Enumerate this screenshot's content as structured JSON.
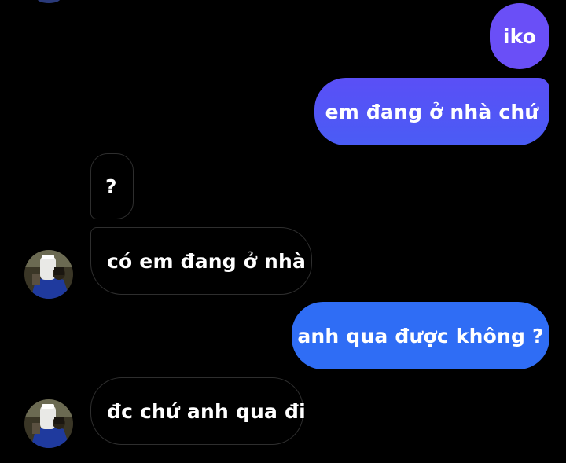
{
  "theme": {
    "background": "#000000",
    "outgoing_gradient_top": "#6f4cf6",
    "outgoing_gradient_bottom": "#2f6df5",
    "incoming_background": "#000000",
    "incoming_border": "#2e2e2e",
    "text_color": "#ffffff"
  },
  "messages": [
    {
      "direction": "outgoing",
      "text": "iko"
    },
    {
      "direction": "outgoing",
      "text": "em đang ở nhà chứ"
    },
    {
      "direction": "incoming",
      "text": "?"
    },
    {
      "direction": "incoming",
      "text": "có em đang ở nhà",
      "avatar": "contact-avatar"
    },
    {
      "direction": "outgoing",
      "text": "anh qua được không ?"
    },
    {
      "direction": "incoming",
      "text": "đc chứ anh qua đi",
      "avatar": "contact-avatar"
    }
  ]
}
